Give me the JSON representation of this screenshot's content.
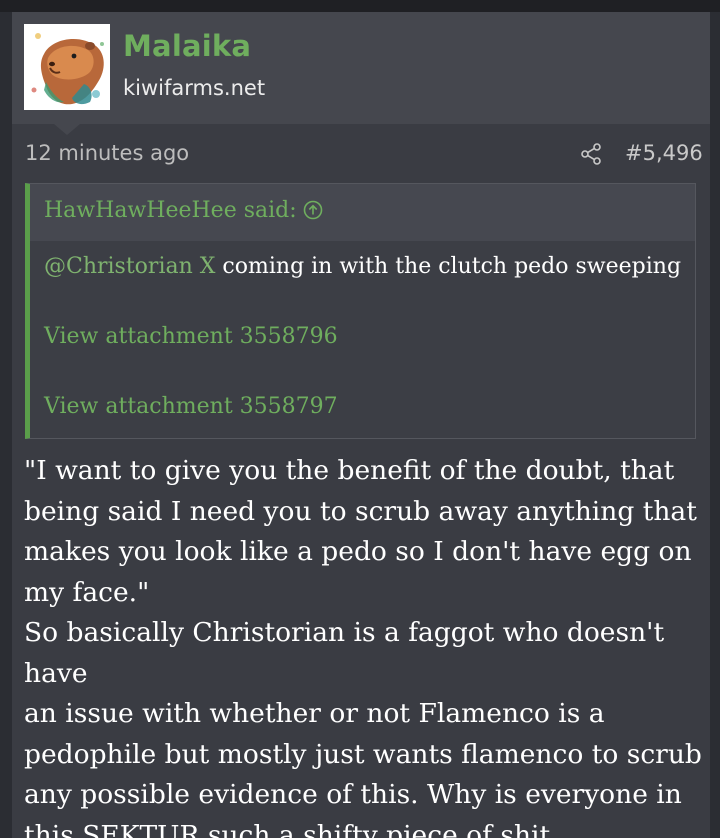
{
  "post": {
    "username": "Malaika",
    "user_title": "kiwifarms.net",
    "timestamp": "12 minutes ago",
    "post_number": "#5,496",
    "colors": {
      "username": "#6fae5e",
      "quote_border": "#5a9e4a",
      "background": "#3a3c43"
    },
    "icons": {
      "share": "share-icon",
      "quote_jump": "arrow-up-circle-icon",
      "avatar": "capybara-watercolor-avatar"
    }
  },
  "quote": {
    "author_label": "HawHawHeeHee said:",
    "mention": "@Christorian X",
    "text": " coming in with the clutch pedo sweeping",
    "attachments": [
      "View attachment 3558796",
      "View attachment 3558797"
    ]
  },
  "message": {
    "lines": [
      "\"I want to give you the benefit of the doubt, that",
      "being said I need you to scrub away anything that",
      "makes you look like a pedo so I don't have egg on",
      "my face.\"",
      "So basically Christorian is a faggot who doesn't have",
      "an issue with whether or not Flamenco is a",
      "pedophile but mostly just wants flamenco to scrub",
      "any possible evidence of this. Why is everyone in",
      "this SEKTUR such a shifty piece of shit."
    ]
  }
}
